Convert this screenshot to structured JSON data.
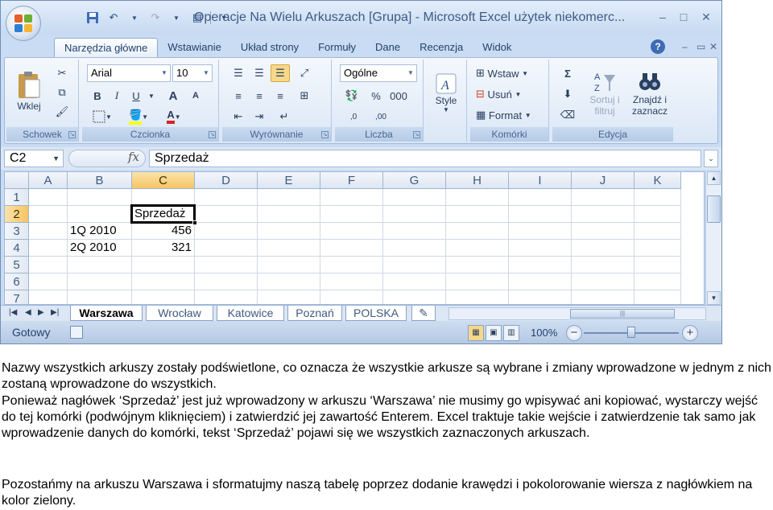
{
  "window": {
    "title": "Operacje Na Wielu Arkuszach [Grupa] - Microsoft Excel użytek niekomerc...",
    "minimize": "–",
    "maximize": "□",
    "close": "✕"
  },
  "quick_access": {
    "save_icon": "save-icon",
    "undo_icon": "undo-icon",
    "redo_icon": "redo-icon"
  },
  "ribbon_tabs": [
    "Narzędzia główne",
    "Wstawianie",
    "Układ strony",
    "Formuły",
    "Dane",
    "Recenzja",
    "Widok"
  ],
  "help": "?",
  "ribbon": {
    "schowek": {
      "paste_label": "Wklej",
      "group_label": "Schowek"
    },
    "czcionka": {
      "font_name": "Arial",
      "font_size": "10",
      "bold": "B",
      "italic": "I",
      "underline": "U",
      "grow": "A",
      "shrink": "A",
      "font_color": "A",
      "group_label": "Czcionka"
    },
    "wyrownanie": {
      "group_label": "Wyrównanie"
    },
    "liczba": {
      "format": "Ogólne",
      "percent": "%",
      "thousands": "000",
      "inc_dec": ",0",
      "dec_dec": ",00",
      "group_label": "Liczba"
    },
    "style": {
      "label": "Style"
    },
    "komorki": {
      "insert": "Wstaw",
      "delete": "Usuń",
      "format": "Format",
      "group_label": "Komórki"
    },
    "edycja": {
      "sum": "Σ",
      "sort_label_1": "Sortuj i",
      "sort_label_2": "filtruj",
      "find_label_1": "Znajdź i",
      "find_label_2": "zaznacz",
      "group_label": "Edycja"
    }
  },
  "formula_bar": {
    "name_box": "C2",
    "fx": "fx",
    "content": "Sprzedaż"
  },
  "grid": {
    "columns": [
      "A",
      "B",
      "C",
      "D",
      "E",
      "F",
      "G",
      "H",
      "I",
      "J",
      "K"
    ],
    "rows": [
      "1",
      "2",
      "3",
      "4",
      "5",
      "6",
      "7"
    ],
    "cells": {
      "C2": "Sprzedaż",
      "B3": "1Q 2010",
      "C3": "456",
      "B4": "2Q 2010",
      "C4": "321"
    },
    "active_cell": "C2"
  },
  "sheets": [
    "Warszawa",
    "Wrocław",
    "Katowice",
    "Poznań",
    "POLSKA"
  ],
  "active_sheet": "Warszawa",
  "status": {
    "ready": "Gotowy",
    "zoom": "100%"
  },
  "article": {
    "p1": "Nazwy wszystkich arkuszy zostały podświetlone, co oznacza że wszystkie arkusze są wybrane i zmiany wprowadzone w jednym z nich zostaną wprowadzone do wszystkich.",
    "p2": "Ponieważ nagłówek ‘Sprzedaż’ jest już wprowadzony w arkuszu ‘Warszawa’ nie musimy go wpisywać ani kopiować, wystarczy wejść do tej komórki (podwójnym kliknięciem) i zatwierdzić jej zawartość Enterem. Excel traktuje takie wejście i zatwierdzenie tak samo jak wprowadzenie danych do komórki, tekst ‘Sprzedaż’ pojawi się we wszystkich zaznaczonych arkuszach.",
    "p3": "Pozostańmy na  arkuszu Warszawa i sformatujmy naszą tabelę poprzez dodanie krawędzi i pokolorowanie wiersza z nagłówkiem na kolor zielony."
  }
}
